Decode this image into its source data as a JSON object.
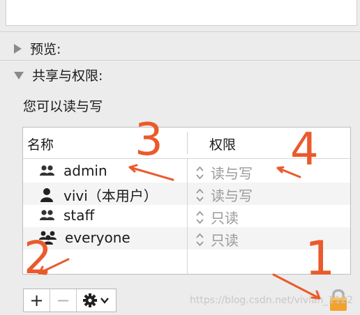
{
  "sections": {
    "preview_label": "预览:",
    "sharing_label": "共享与权限:"
  },
  "permission_description": "您可以读与写",
  "table": {
    "columns": [
      "名称",
      "权限"
    ],
    "rows": [
      {
        "name": "admin",
        "permission": "读与写",
        "icon": "group-icon"
      },
      {
        "name": "vivi（本用户）",
        "permission": "读与写",
        "icon": "user-icon"
      },
      {
        "name": "staff",
        "permission": "只读",
        "icon": "group-icon"
      },
      {
        "name": "everyone",
        "permission": "只读",
        "icon": "everyone-icon"
      }
    ]
  },
  "toolbar": {
    "add_label": "+",
    "remove_label": "−",
    "action_icon": "gear-icon"
  },
  "annotations": [
    "1",
    "2",
    "3",
    "4"
  ],
  "watermark": "https://blog.csdn.net/vivian_1122",
  "colors": {
    "annotation": "#ea5a2c",
    "lock": "#f0a22e"
  }
}
